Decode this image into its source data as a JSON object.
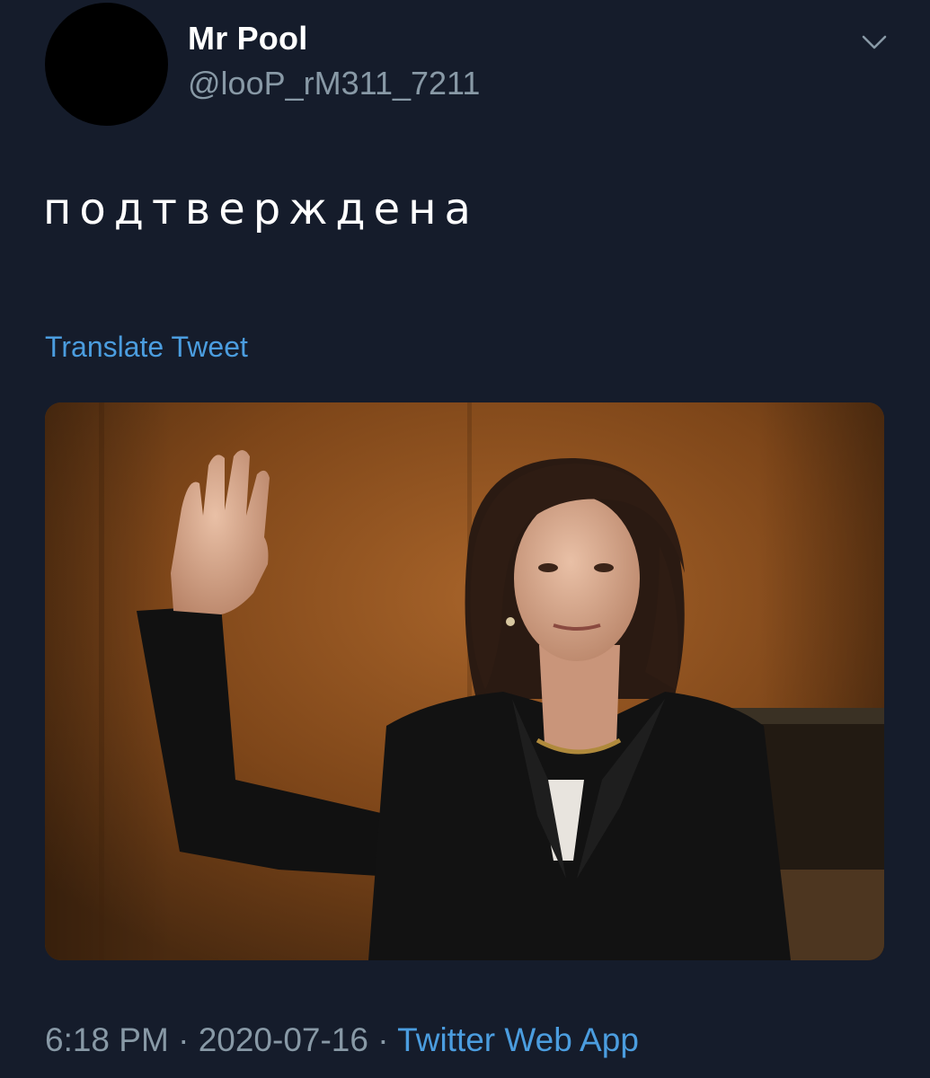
{
  "tweet": {
    "display_name": "Mr Pool",
    "handle": "@looP_rM311_7211",
    "text": "подтверждена",
    "translate_label": "Translate Tweet",
    "time": "6:18 PM",
    "separator": " · ",
    "date": "2020-07-16",
    "source": "Twitter Web App",
    "menu_icon": "chevron-down-icon",
    "media_alt": "Photo of a woman in a black suit raising her right hand to take an oath in front of a wood-paneled wall"
  },
  "colors": {
    "background": "#151c2b",
    "name": "#ffffff",
    "secondary": "#8899a6",
    "link": "#4b9ddf"
  }
}
